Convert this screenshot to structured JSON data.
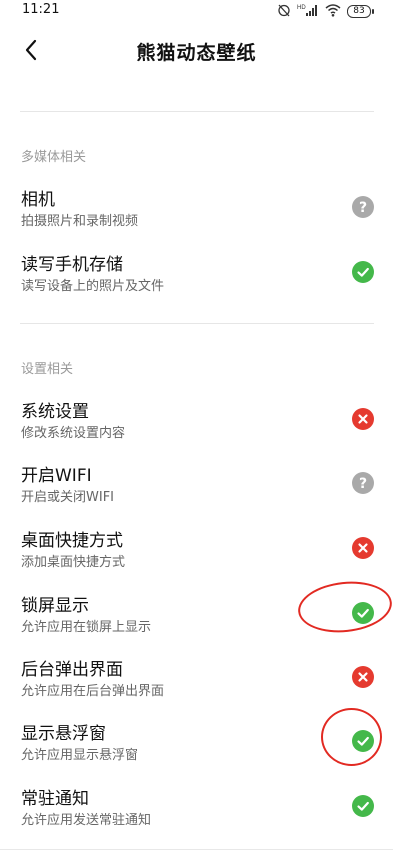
{
  "status_bar": {
    "time": "11:21",
    "battery": "83",
    "icons": [
      "alarm-off-icon",
      "hd-signal-icon",
      "wifi-icon",
      "battery-icon"
    ]
  },
  "header": {
    "title": "熊猫动态壁纸",
    "back_icon": "back-arrow-icon"
  },
  "sections": [
    {
      "label": "多媒体相关",
      "items": [
        {
          "title": "相机",
          "desc": "拍摄照片和录制视频",
          "status": "unknown"
        },
        {
          "title": "读写手机存储",
          "desc": "读写设备上的照片及文件",
          "status": "allowed"
        }
      ]
    },
    {
      "label": "设置相关",
      "items": [
        {
          "title": "系统设置",
          "desc": "修改系统设置内容",
          "status": "denied"
        },
        {
          "title": "开启WIFI",
          "desc": "开启或关闭WIFI",
          "status": "unknown"
        },
        {
          "title": "桌面快捷方式",
          "desc": "添加桌面快捷方式",
          "status": "denied"
        },
        {
          "title": "锁屏显示",
          "desc": "允许应用在锁屏上显示",
          "status": "allowed"
        },
        {
          "title": "后台弹出界面",
          "desc": "允许应用在后台弹出界面",
          "status": "denied"
        },
        {
          "title": "显示悬浮窗",
          "desc": "允许应用显示悬浮窗",
          "status": "allowed"
        },
        {
          "title": "常驻通知",
          "desc": "允许应用发送常驻通知",
          "status": "allowed"
        }
      ]
    }
  ],
  "colors": {
    "allowed": "#44b84a",
    "denied": "#e53a2f",
    "unknown": "#a9a9a9",
    "annotation": "#e22a22"
  }
}
